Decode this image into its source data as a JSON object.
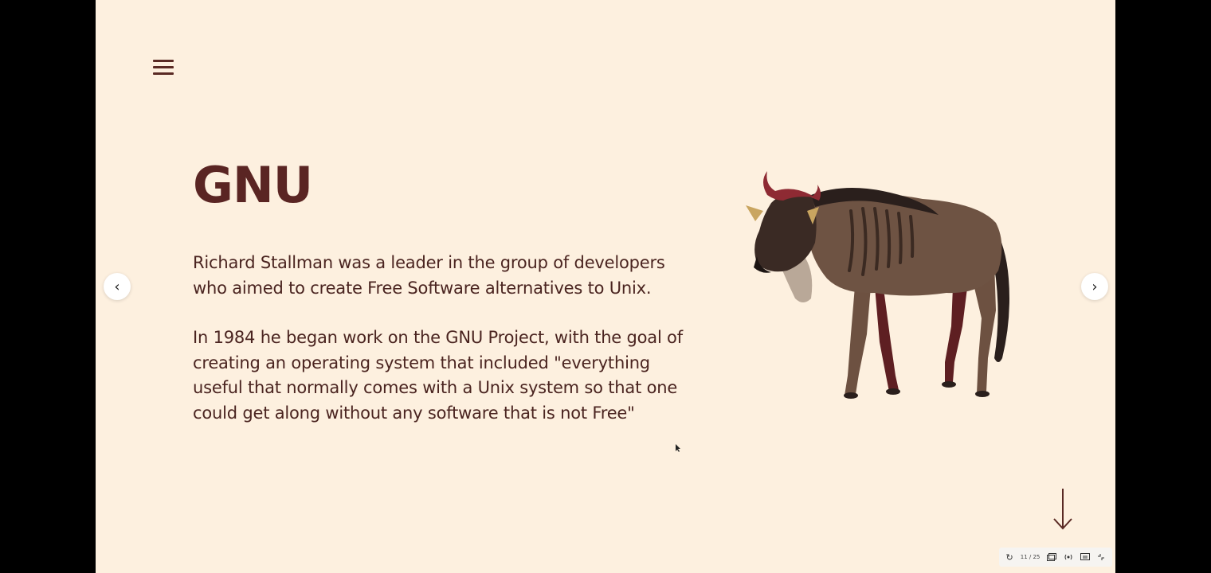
{
  "slide": {
    "title": "GNU",
    "paragraph1": "Richard Stallman was a leader in the group of developers who aimed to create Free Software alternatives to Unix.",
    "paragraph2": "In 1984 he began work on the GNU Project, with the goal of creating an operating system that included \"everything useful that normally comes with a Unix system so that one could get along without any software that is not Free\""
  },
  "navigation": {
    "prev_icon": "chevron-left-icon",
    "next_icon": "chevron-right-icon",
    "prev_glyph": "‹",
    "next_glyph": "›",
    "menu_icon": "hamburger-menu-icon",
    "down_icon": "arrow-down-icon"
  },
  "toolbar": {
    "counter": "11 / 25",
    "replay_glyph": "↻",
    "icons": [
      "replay-icon",
      "slide-counter",
      "overview-icon",
      "broadcast-icon",
      "captions-icon",
      "fullscreen-exit-icon"
    ]
  },
  "colors": {
    "background": "#fdf0df",
    "text": "#4a2420",
    "title": "#5a2523",
    "letterbox": "#000000"
  }
}
